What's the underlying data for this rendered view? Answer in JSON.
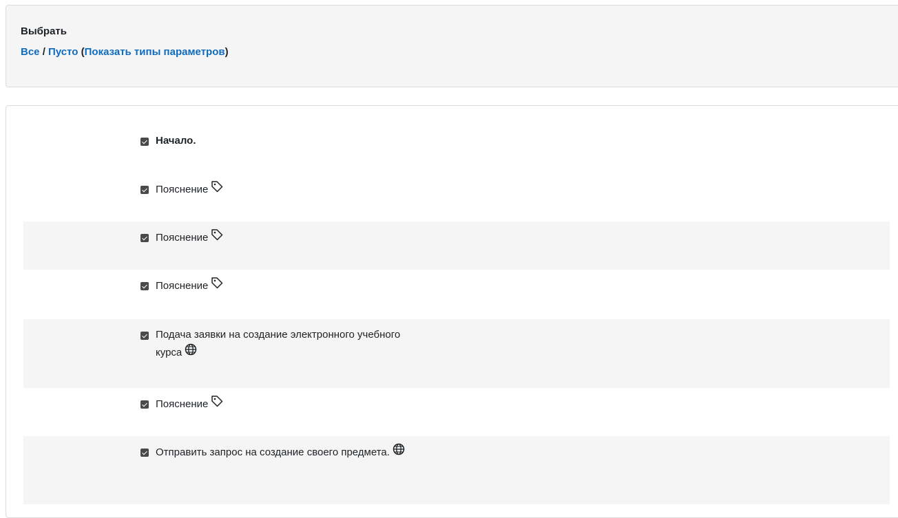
{
  "select": {
    "title": "Выбрать",
    "all_label": "Все",
    "separator": "/",
    "none_label": "Пусто",
    "paren_open": "(",
    "show_types_label": "Показать типы параметров",
    "paren_close": ")"
  },
  "items": [
    {
      "label": "Начало.",
      "checked": true,
      "bold": true,
      "icon": null
    },
    {
      "label": "Пояснение",
      "checked": true,
      "bold": false,
      "icon": "tag-icon"
    },
    {
      "label": "Пояснение",
      "checked": true,
      "bold": false,
      "icon": "tag-icon"
    },
    {
      "label": "Пояснение",
      "checked": true,
      "bold": false,
      "icon": "tag-icon"
    },
    {
      "label": "Подача заявки на создание электронного учебного курса",
      "checked": true,
      "bold": false,
      "icon": "globe-icon"
    },
    {
      "label": "Пояснение",
      "checked": true,
      "bold": false,
      "icon": "tag-icon"
    },
    {
      "label": "Отправить запрос на создание своего предмета.",
      "checked": true,
      "bold": false,
      "icon": "globe-icon"
    }
  ],
  "colors": {
    "link": "#0f6cbf",
    "panel_bg": "#f5f5f5",
    "checkbox": "#4a4a4a"
  }
}
